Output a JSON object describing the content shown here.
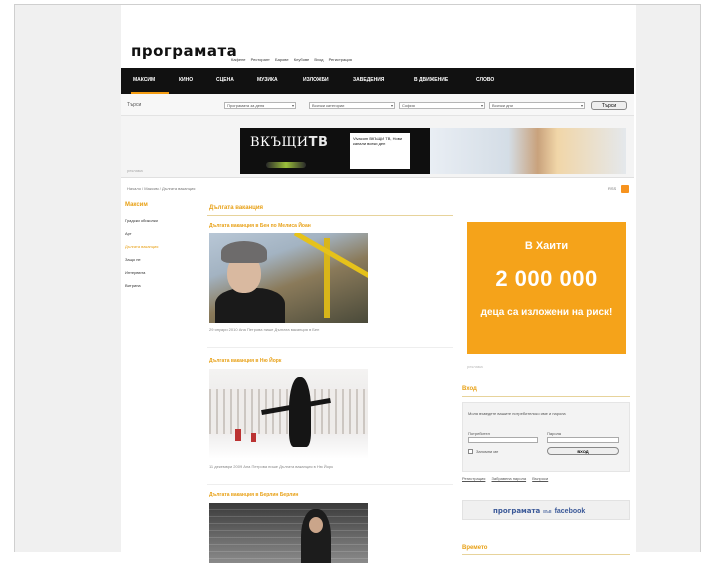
{
  "site": {
    "logo": "програмата"
  },
  "top_links": [
    "Кафене",
    "Ресторант",
    "Барове",
    "Клубове",
    "Вход",
    "Регистрация"
  ],
  "nav": {
    "items": [
      "МАКСИМ",
      "КИНО",
      "СЦЕНА",
      "МУЗИКА",
      "ИЗЛОЖБИ",
      "ЗАВЕДЕНИЯ",
      "В ДВИЖЕНИЕ",
      "СЛОВО"
    ],
    "active_index": 0
  },
  "filter": {
    "label": "Търси",
    "select_1": "Програмата за деня",
    "select_2": "Всички категории",
    "select_3": "София",
    "select_4": "Всички дни",
    "search_button": "Търси"
  },
  "ad": {
    "label": "реклама",
    "tv_text_1": "ВКЪЩИ",
    "tv_text_2": "ТВ",
    "tag_text": "Vivacom ВКЪЩИ ТВ, Нови канали всеки ден"
  },
  "breadcrumb": "Начало / Максим / Дългата ваканция",
  "rss_label": "RSS",
  "sidebar": {
    "title": "Максим",
    "items": [
      "Градски обиколки",
      "Арт",
      "Дългата ваканция",
      "Защо не",
      "Интервюта",
      "Витрина"
    ],
    "active_index": 2
  },
  "main": {
    "section_title": "Дългата ваканция",
    "posts": [
      {
        "title": "Дългата ваканция в Бен по Мелиса Йоан",
        "meta": "29 януари 2010 Ана Петрова пише Дългата ваканция в Бен"
      },
      {
        "title": "Дългата ваканция в Ню Йорк",
        "meta": "11 декември 2009 Ана Петрова пише Дългата ваканция в Ню Йорк"
      },
      {
        "title": "Дългата ваканция в Берлин Берлин",
        "meta": ""
      }
    ]
  },
  "promo": {
    "line1": "В Хаити",
    "line2": "2 000 000",
    "line3": "деца са изложени на риск!",
    "footer": "реклама",
    "color": "#f5a31a"
  },
  "login": {
    "title": "Вход",
    "text": "Моля въведете вашите потребителско име и парола",
    "username_label": "Потребител",
    "password_label": "Парола",
    "remember_label": "Запомни ме",
    "submit": "ВХОД",
    "links": [
      "Регистрация",
      "Забравена парола",
      "Въпроси"
    ]
  },
  "facebook": {
    "brand": "програмата",
    "on": "във",
    "network": "facebook"
  },
  "bottom_title": "Времето",
  "colors": {
    "accent": "#e8a117",
    "nav_bg": "#111111"
  }
}
